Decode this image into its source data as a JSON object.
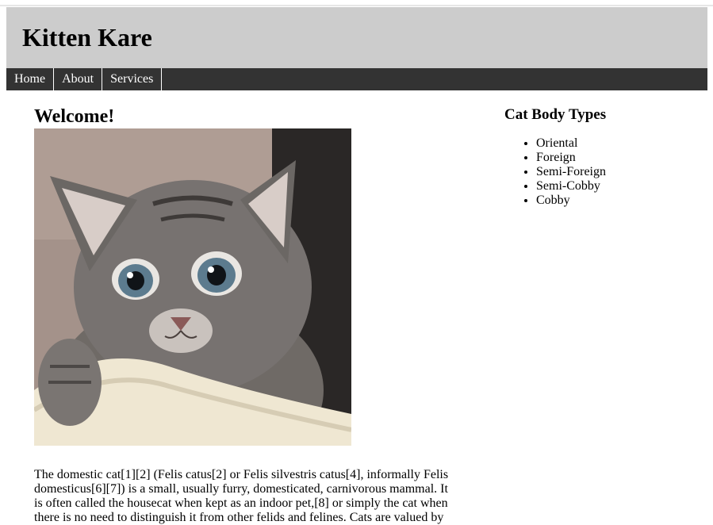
{
  "header": {
    "title": "Kitten Kare"
  },
  "nav": {
    "items": [
      "Home",
      "About",
      "Services"
    ]
  },
  "main": {
    "heading": "Welcome!",
    "paragraph": "The domestic cat[1][2] (Felis catus[2] or Felis silvestris catus[4], informally Felis domesticus[6][7]) is a small, usually furry, domesticated, carnivorous mammal. It is often called the housecat when kept as an indoor pet,[8] or simply the cat when there is no need to distinguish it from other felids and felines. Cats are valued by"
  },
  "sidebar": {
    "title": "Cat Body Types",
    "items": [
      "Oriental",
      "Foreign",
      "Semi-Foreign",
      "Semi-Cobby",
      "Cobby"
    ]
  }
}
